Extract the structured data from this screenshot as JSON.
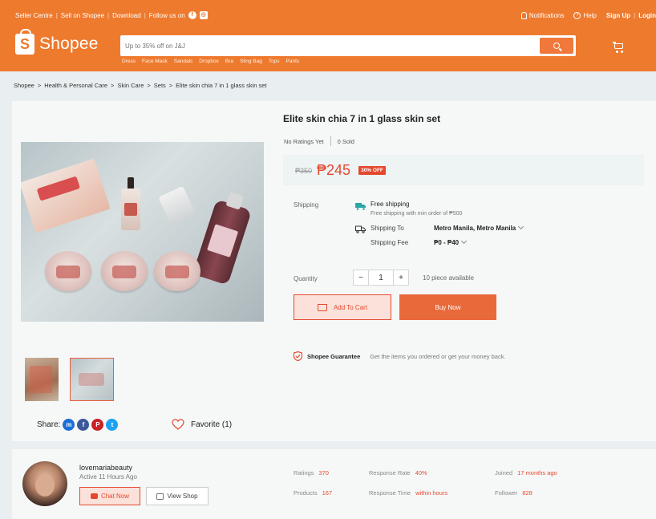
{
  "topbar": {
    "seller_centre": "Seller Centre",
    "sell_on_shopee": "Sell on Shopee",
    "download": "Download",
    "follow_us": "Follow us on",
    "notifications": "Notifications",
    "help": "Help",
    "sign_up": "Sign Up",
    "login": "Login"
  },
  "header": {
    "logo_text": "Shopee",
    "search_placeholder": "Up to 35% off on J&J",
    "keywords": [
      "Dress",
      "Face Mask",
      "Sandals",
      "Dropbox",
      "Bra",
      "Sling Bag",
      "Tops",
      "Pants"
    ]
  },
  "breadcrumb": [
    "Shopee",
    "Health & Personal Care",
    "Skin Care",
    "Sets",
    "Elite skin chia 7 in 1 glass skin set"
  ],
  "breadcrumb_sep": ">",
  "product": {
    "title": "Elite skin chia 7 in 1 glass skin set",
    "ratings": "No Ratings Yet",
    "sold": "0 Sold",
    "old_price": "₱350",
    "new_price": "₱245",
    "discount": "30% OFF",
    "shipping_label": "Shipping",
    "free_shipping": "Free shipping",
    "free_shipping_sub": "Free shipping with min order of ₱500",
    "shipping_to_label": "Shipping To",
    "shipping_to_value": "Metro Manila, Metro Manila",
    "shipping_fee_label": "Shipping Fee",
    "shipping_fee_value": "₱0 - ₱40",
    "quantity_label": "Quantity",
    "quantity_minus": "−",
    "quantity_value": "1",
    "quantity_plus": "+",
    "stock": "10 piece available",
    "add_to_cart": "Add To Cart",
    "buy_now": "Buy Now",
    "guarantee_title": "Shopee Guarantee",
    "guarantee_sub": "Get the items you ordered or get your money back."
  },
  "share": {
    "label": "Share:",
    "favorite": "Favorite (1)"
  },
  "seller": {
    "name": "lovemariabeauty",
    "active": "Active 11 Hours Ago",
    "chat_now": "Chat Now",
    "view_shop": "View Shop",
    "stats": {
      "ratings_label": "Ratings",
      "ratings_value": "370",
      "response_rate_label": "Response Rate",
      "response_rate_value": "40%",
      "joined_label": "Joined",
      "joined_value": "17 months ago",
      "products_label": "Products",
      "products_value": "167",
      "response_time_label": "Response Time",
      "response_time_value": "within hours",
      "follower_label": "Follower",
      "follower_value": "828"
    }
  },
  "colors": {
    "brand": "#ee7a2e",
    "accent": "#e4492f"
  }
}
